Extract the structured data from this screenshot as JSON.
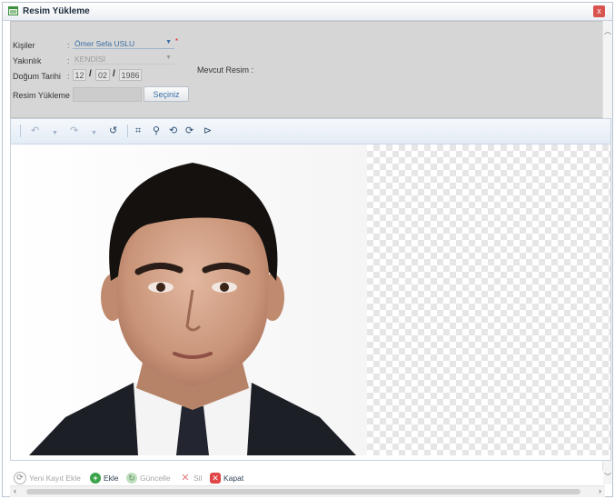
{
  "window": {
    "title": "Resim Yükleme",
    "close_label": "x"
  },
  "form": {
    "kisiler": {
      "label": "Kişiler",
      "colon": ":",
      "value": "Ömer Sefa USLU",
      "required_mark": "*"
    },
    "yakinlik": {
      "label": "Yakınlık",
      "colon": ":",
      "value": "KENDİSİ"
    },
    "dogum_tarihi": {
      "label": "Doğum Tarihi",
      "colon": ":",
      "day": "12",
      "month": "02",
      "year": "1986",
      "separator": "/"
    },
    "resim_yukleme": {
      "label": "Resim Yükleme :",
      "button": "Seçiniz"
    },
    "mevcut_resim": {
      "label": "Mevcut Resim :"
    }
  },
  "toolbar": {
    "icons": [
      "undo-icon",
      "undo-dropdown-icon",
      "redo-icon",
      "redo-dropdown-icon",
      "reset-icon",
      "crop-icon",
      "zoom-icon",
      "rotate-left-icon",
      "rotate-right-icon",
      "flip-icon"
    ]
  },
  "actions": {
    "new": "Yeni Kayıt Ekle",
    "add": "Ekle",
    "update": "Güncelle",
    "delete": "Sil",
    "close": "Kapat"
  },
  "colors": {
    "checker": "#e6e6e6",
    "accent": "#3a6ea5",
    "close": "#d9534f"
  }
}
